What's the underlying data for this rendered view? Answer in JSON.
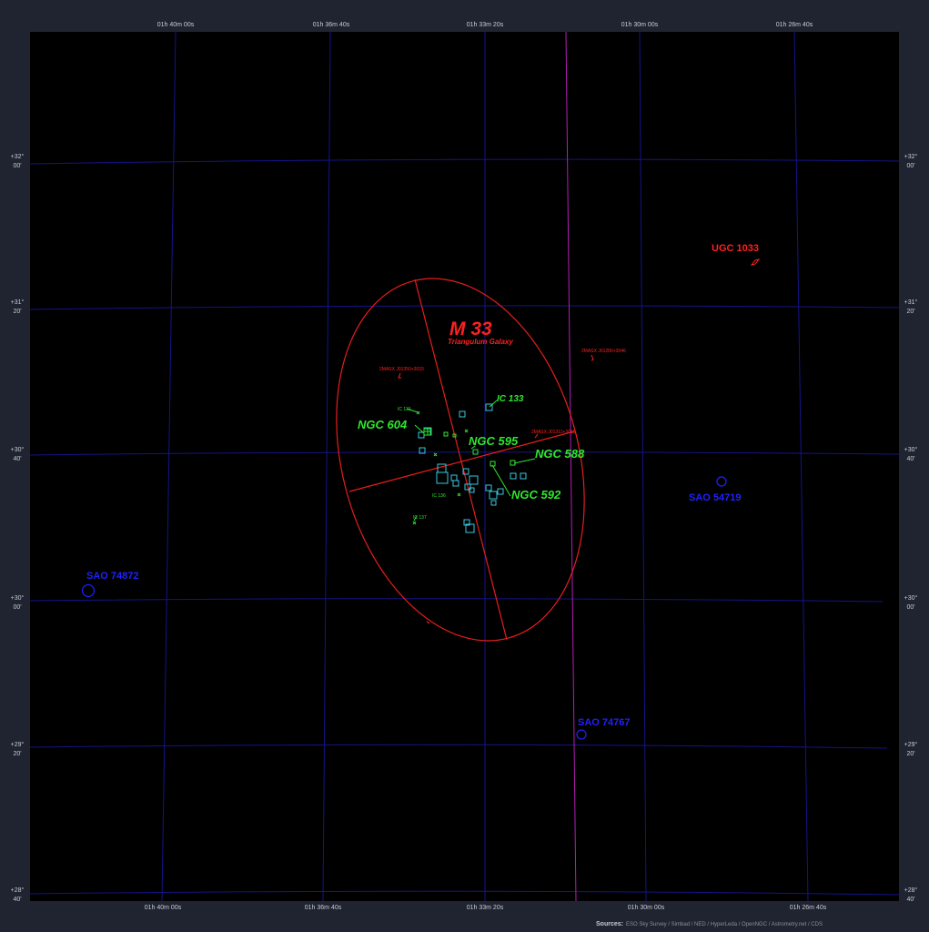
{
  "map": {
    "ra_labels": [
      "01h 40m 00s",
      "01h 36m 40s",
      "01h 33m 20s",
      "01h 30m 00s",
      "01h 26m 40s"
    ],
    "dec_labels": [
      [
        "+32°",
        "00'"
      ],
      [
        "+31°",
        "20'"
      ],
      [
        "+30°",
        "40'"
      ],
      [
        "+30°",
        "00'"
      ],
      [
        "+29°",
        "20'"
      ],
      [
        "+28°",
        "40'"
      ]
    ],
    "main_object": {
      "name": "M 33",
      "common_name": "Triangulum Galaxy"
    },
    "green_labels": [
      "NGC 604",
      "NGC 595",
      "NGC 588",
      "NGC 592",
      "IC 133"
    ],
    "green_small_labels": [
      "IC 131",
      "IC 136",
      "IC 137"
    ],
    "red_labels": [
      "UGC 1033"
    ],
    "red_small_labels": [
      "2MASX J01350+3033",
      "2MASX J01280+3046",
      "2MASX J01311+3015"
    ],
    "stars": [
      "SAO 74872",
      "SAO 54719",
      "SAO 74767"
    ],
    "sources": {
      "label": "Sources:",
      "text": "ESO Sky Survey / Simbad / NED / HyperLeda / OpenNGC / Astrometry.net / CDS"
    },
    "colors": {
      "grid": "#14148c",
      "meridian": "#b41eb4",
      "ellipse": "#e61e1e",
      "green": "#2ee82e",
      "cyan": "#3ac8e0",
      "red": "#ff2020",
      "blue": "#2020ff",
      "background": "#000000",
      "frame": "#1f2430"
    }
  }
}
